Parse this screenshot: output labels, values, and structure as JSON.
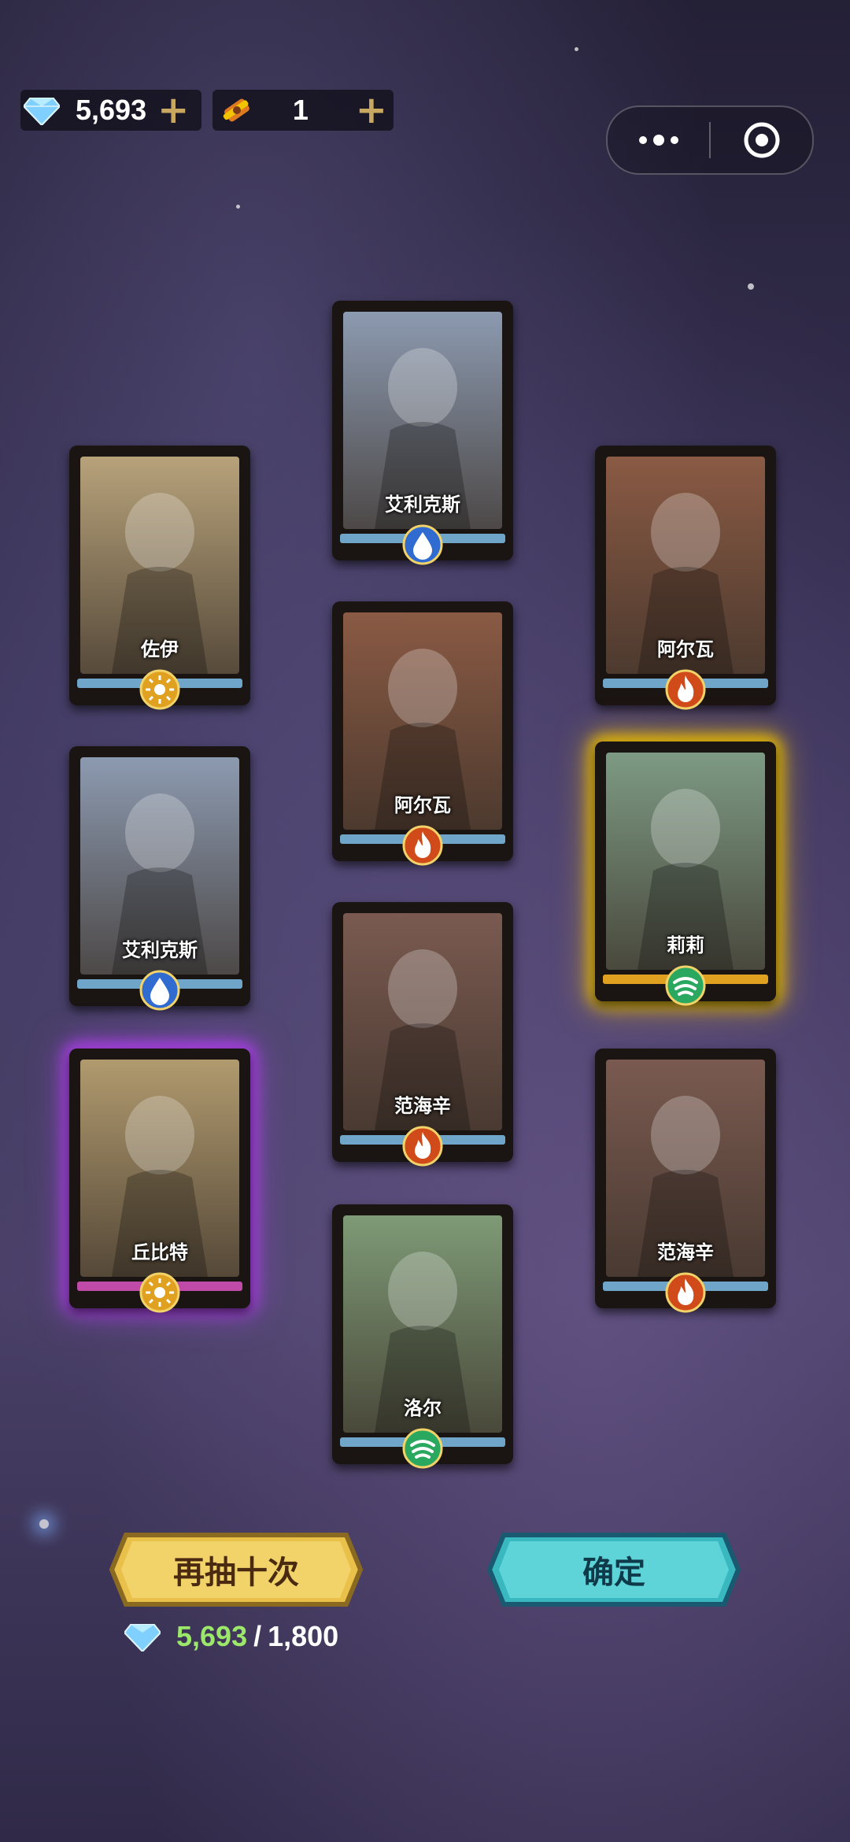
{
  "currencies": [
    {
      "icon": "diamond-icon",
      "value": "5,693"
    },
    {
      "icon": "summon-scroll-icon",
      "value": "1"
    }
  ],
  "cards": [
    {
      "name": "艾利克斯",
      "element": "water",
      "color": "#2f6bd1",
      "band": "#6fa5c8",
      "bg": "#8c9ab0"
    },
    {
      "name": "佐伊",
      "element": "light",
      "color": "#e0a020",
      "band": "#6fa5c8",
      "bg": "#b7a27a"
    },
    {
      "name": "阿尔瓦",
      "element": "fire",
      "color": "#d04a1a",
      "band": "#6fa5c8",
      "bg": "#8a5a44"
    },
    {
      "name": "阿尔瓦",
      "element": "fire",
      "color": "#d04a1a",
      "band": "#6fa5c8",
      "bg": "#8a5a44"
    },
    {
      "name": "莉莉",
      "element": "wind",
      "color": "#2aa860",
      "band": "#e0a020",
      "bg": "#7d9a84"
    },
    {
      "name": "艾利克斯",
      "element": "water",
      "color": "#2f6bd1",
      "band": "#6fa5c8",
      "bg": "#8c9ab0"
    },
    {
      "name": "范海辛",
      "element": "fire",
      "color": "#d04a1a",
      "band": "#6fa5c8",
      "bg": "#7a5a50"
    },
    {
      "name": "丘比特",
      "element": "light",
      "color": "#e0a020",
      "band": "#c04aa8",
      "bg": "#b09a6e"
    },
    {
      "name": "范海辛",
      "element": "fire",
      "color": "#d04a1a",
      "band": "#6fa5c8",
      "bg": "#7a5a50"
    },
    {
      "name": "洛尔",
      "element": "wind",
      "color": "#2aa860",
      "band": "#6fa5c8",
      "bg": "#7e9a76"
    }
  ],
  "buttons": {
    "redraw": "再抽十次",
    "confirm": "确定"
  },
  "cost": {
    "have": "5,693",
    "separator": "/",
    "need": "1,800"
  },
  "colors": {
    "gold": "#f2c400",
    "purple": "#b240f0",
    "teal": "#3ab8c0",
    "gem": "#8ad8ff"
  }
}
